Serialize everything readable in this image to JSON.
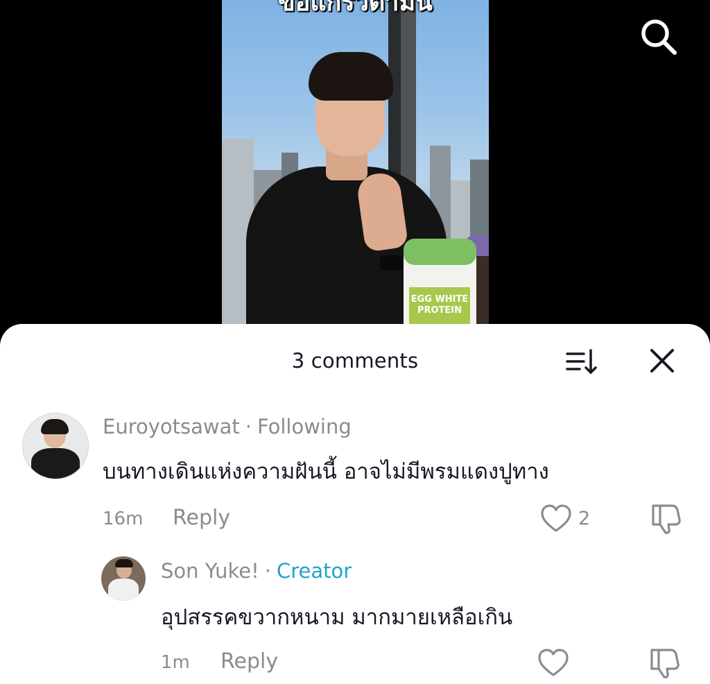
{
  "video": {
    "caption": "ขอแกรวิตามิน",
    "product_label": "EGG WHITE PROTEIN"
  },
  "sheet": {
    "title": "3 comments"
  },
  "comments": [
    {
      "username": "Euroyotsawat",
      "separator": "·",
      "tag": "Following",
      "text": "บนทางเดินแห่งความฝันนี้ อาจไม่มีพรมแดงปูทาง",
      "time": "16m",
      "reply_label": "Reply",
      "likes": "2"
    },
    {
      "username": "Son Yuke!",
      "separator": "·",
      "tag": "Creator",
      "text": "อุปสรรคขวากหนาม มากมายเหลือเกิน",
      "time": "1m",
      "reply_label": "Reply",
      "likes": ""
    }
  ],
  "colors": {
    "secondary_text": "#8a8b91",
    "creator_tag": "#20a4c8",
    "primary_text": "#161823"
  },
  "icons": {
    "search": "search-icon",
    "sort": "sort-icon",
    "close": "close-icon",
    "like": "heart-icon",
    "dislike": "thumbs-down-icon"
  }
}
